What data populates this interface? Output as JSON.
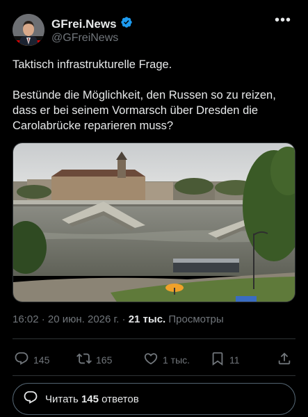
{
  "author": {
    "display_name": "GFrei.News",
    "handle": "@GFreiNews",
    "verified": true
  },
  "menu": {
    "more_label": "•••"
  },
  "tweet": {
    "paragraphs": [
      "Taktisch infrastrukturelle Frage.",
      "Bestünde die Möglichkeit, den Russen so zu reizen, dass er bei seinem Vormarsch über Dresden die Carolabrücke reparieren muss?"
    ]
  },
  "meta": {
    "time": "16:02",
    "separator": "·",
    "date": "20 июн. 2026 г.",
    "views_count": "21 тыс.",
    "views_label": "Просмотры"
  },
  "actions": {
    "replies": "145",
    "reposts": "165",
    "likes": "1 тыс.",
    "bookmarks": "11"
  },
  "reply_button": {
    "prefix": "Читать ",
    "count": "145",
    "suffix": " ответов"
  },
  "colors": {
    "background": "#000000",
    "text": "#e7e9ea",
    "muted": "#71767b",
    "verified": "#1d9bf0",
    "border": "#2f3336"
  }
}
